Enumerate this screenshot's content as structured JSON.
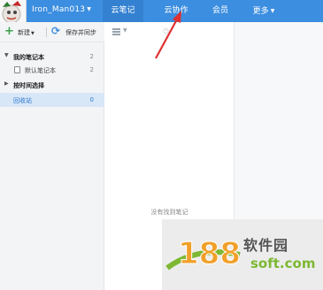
{
  "header": {
    "username": "Iron_Man013",
    "tabs": [
      {
        "label": "云笔记",
        "active": true
      },
      {
        "label": "云协作",
        "active": false
      },
      {
        "label": "会员",
        "active": false
      },
      {
        "label": "更多",
        "active": false
      }
    ],
    "caret_glyph": "▼"
  },
  "toolbar": {
    "new_label": "新建",
    "sync_label": "保存并同步"
  },
  "sidebar": {
    "items": [
      {
        "label": "我的笔记本",
        "count": "2",
        "arrow": "▼"
      },
      {
        "label": "默认笔记本",
        "count": "2"
      },
      {
        "label": "按时间选择",
        "arrow": "▶"
      },
      {
        "label": "回收站",
        "count": "0"
      }
    ]
  },
  "notelist": {
    "empty_text": "没有找到笔记"
  },
  "watermark": {
    "logo_text": "188",
    "name": "软件园",
    "url": "soft.com"
  },
  "colors": {
    "topbar": "#3c8ee0",
    "annotation": "#e03030",
    "selected_bg": "#d8e7f8"
  }
}
